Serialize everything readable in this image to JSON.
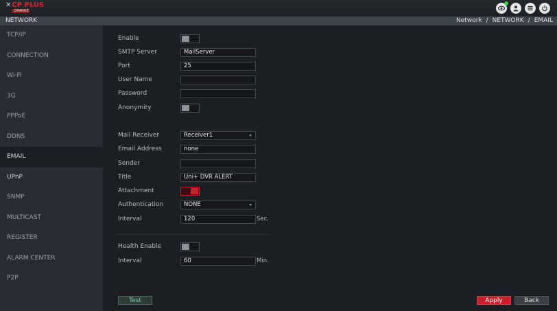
{
  "brand": {
    "name": "CP PLUS",
    "tagline": "ORANGE",
    "mark": "✕"
  },
  "top_icons": [
    "eye-icon",
    "user-icon",
    "menu-icon",
    "power-icon"
  ],
  "header": {
    "title": "NETWORK",
    "crumbs": [
      "Network",
      "NETWORK",
      "EMAIL"
    ],
    "sep": "/"
  },
  "sidebar": {
    "items": [
      "TCP/IP",
      "CONNECTION",
      "Wi-Fi",
      "3G",
      "PPPoE",
      "DDNS",
      "EMAIL",
      "UPnP",
      "SNMP",
      "MULTICAST",
      "REGISTER",
      "ALARM CENTER",
      "P2P"
    ],
    "active": "EMAIL"
  },
  "form": {
    "enable": {
      "label": "Enable",
      "on": false
    },
    "smtp_server": {
      "label": "SMTP Server",
      "value": "MailServer"
    },
    "port": {
      "label": "Port",
      "value": "25"
    },
    "user_name": {
      "label": "User Name",
      "value": ""
    },
    "password": {
      "label": "Password",
      "value": ""
    },
    "anonymity": {
      "label": "Anonymity",
      "on": false
    },
    "mail_receiver": {
      "label": "Mail Receiver",
      "value": "Receiver1"
    },
    "email_address": {
      "label": "Email Address",
      "value": "none"
    },
    "sender": {
      "label": "Sender",
      "value": ""
    },
    "title": {
      "label": "Title",
      "value": "Uni+ DVR ALERT"
    },
    "attachment": {
      "label": "Attachment",
      "on": true
    },
    "authentication": {
      "label": "Authentication",
      "value": "NONE"
    },
    "interval": {
      "label": "Interval",
      "value": "120",
      "unit": "Sec."
    },
    "health_enable": {
      "label": "Health Enable",
      "on": false
    },
    "health_interval": {
      "label": "Interval",
      "value": "60",
      "unit": "Min."
    }
  },
  "buttons": {
    "test": "Test",
    "apply": "Apply",
    "back": "Back"
  },
  "colors": {
    "accent": "#c61f2a",
    "test_text": "#7fd2b0",
    "online": "#3dcc4a"
  }
}
